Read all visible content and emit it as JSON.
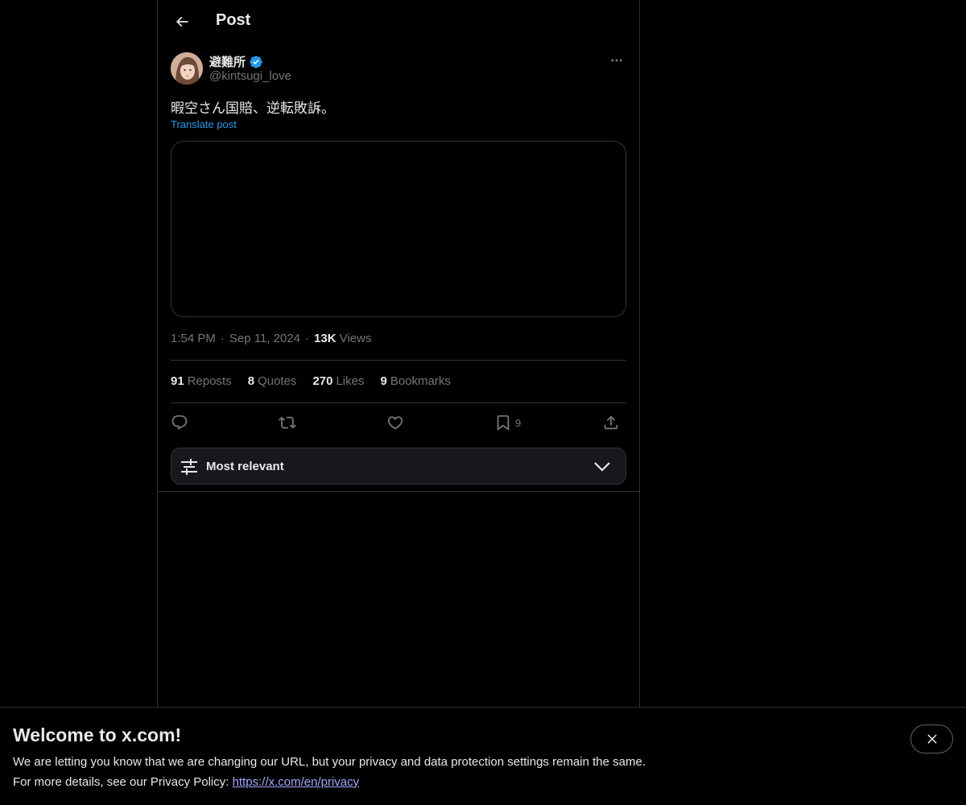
{
  "header": {
    "title": "Post"
  },
  "author": {
    "display_name": "避難所",
    "handle": "@kintsugi_love"
  },
  "post": {
    "text": "暇空さん国賠、逆転敗訴。",
    "translate_label": "Translate post",
    "time": "1:54 PM",
    "date": "Sep 11, 2024",
    "views_count": "13K",
    "views_label": "Views",
    "separator": "·"
  },
  "stats": [
    {
      "count": "91",
      "label": "Reposts"
    },
    {
      "count": "8",
      "label": "Quotes"
    },
    {
      "count": "270",
      "label": "Likes"
    },
    {
      "count": "9",
      "label": "Bookmarks"
    }
  ],
  "actions": {
    "reply_icon": "reply-icon",
    "repost_icon": "repost-icon",
    "like_icon": "heart-icon",
    "bookmark_icon": "bookmark-icon",
    "bookmark_count": "9",
    "share_icon": "share-icon"
  },
  "sort": {
    "label": "Most relevant"
  },
  "banner": {
    "title": "Welcome to x.com!",
    "line1": "We are letting you know that we are changing our URL, but your privacy and data protection settings remain the same.",
    "line2_prefix": "For more details, see our Privacy Policy: ",
    "link_text": "https://x.com/en/privacy"
  },
  "colors": {
    "background": "#000000",
    "text": "#e7e9ea",
    "muted": "#71767b",
    "accent": "#1d9bf0",
    "border": "#2f3336",
    "link": "#a6a5ff"
  }
}
